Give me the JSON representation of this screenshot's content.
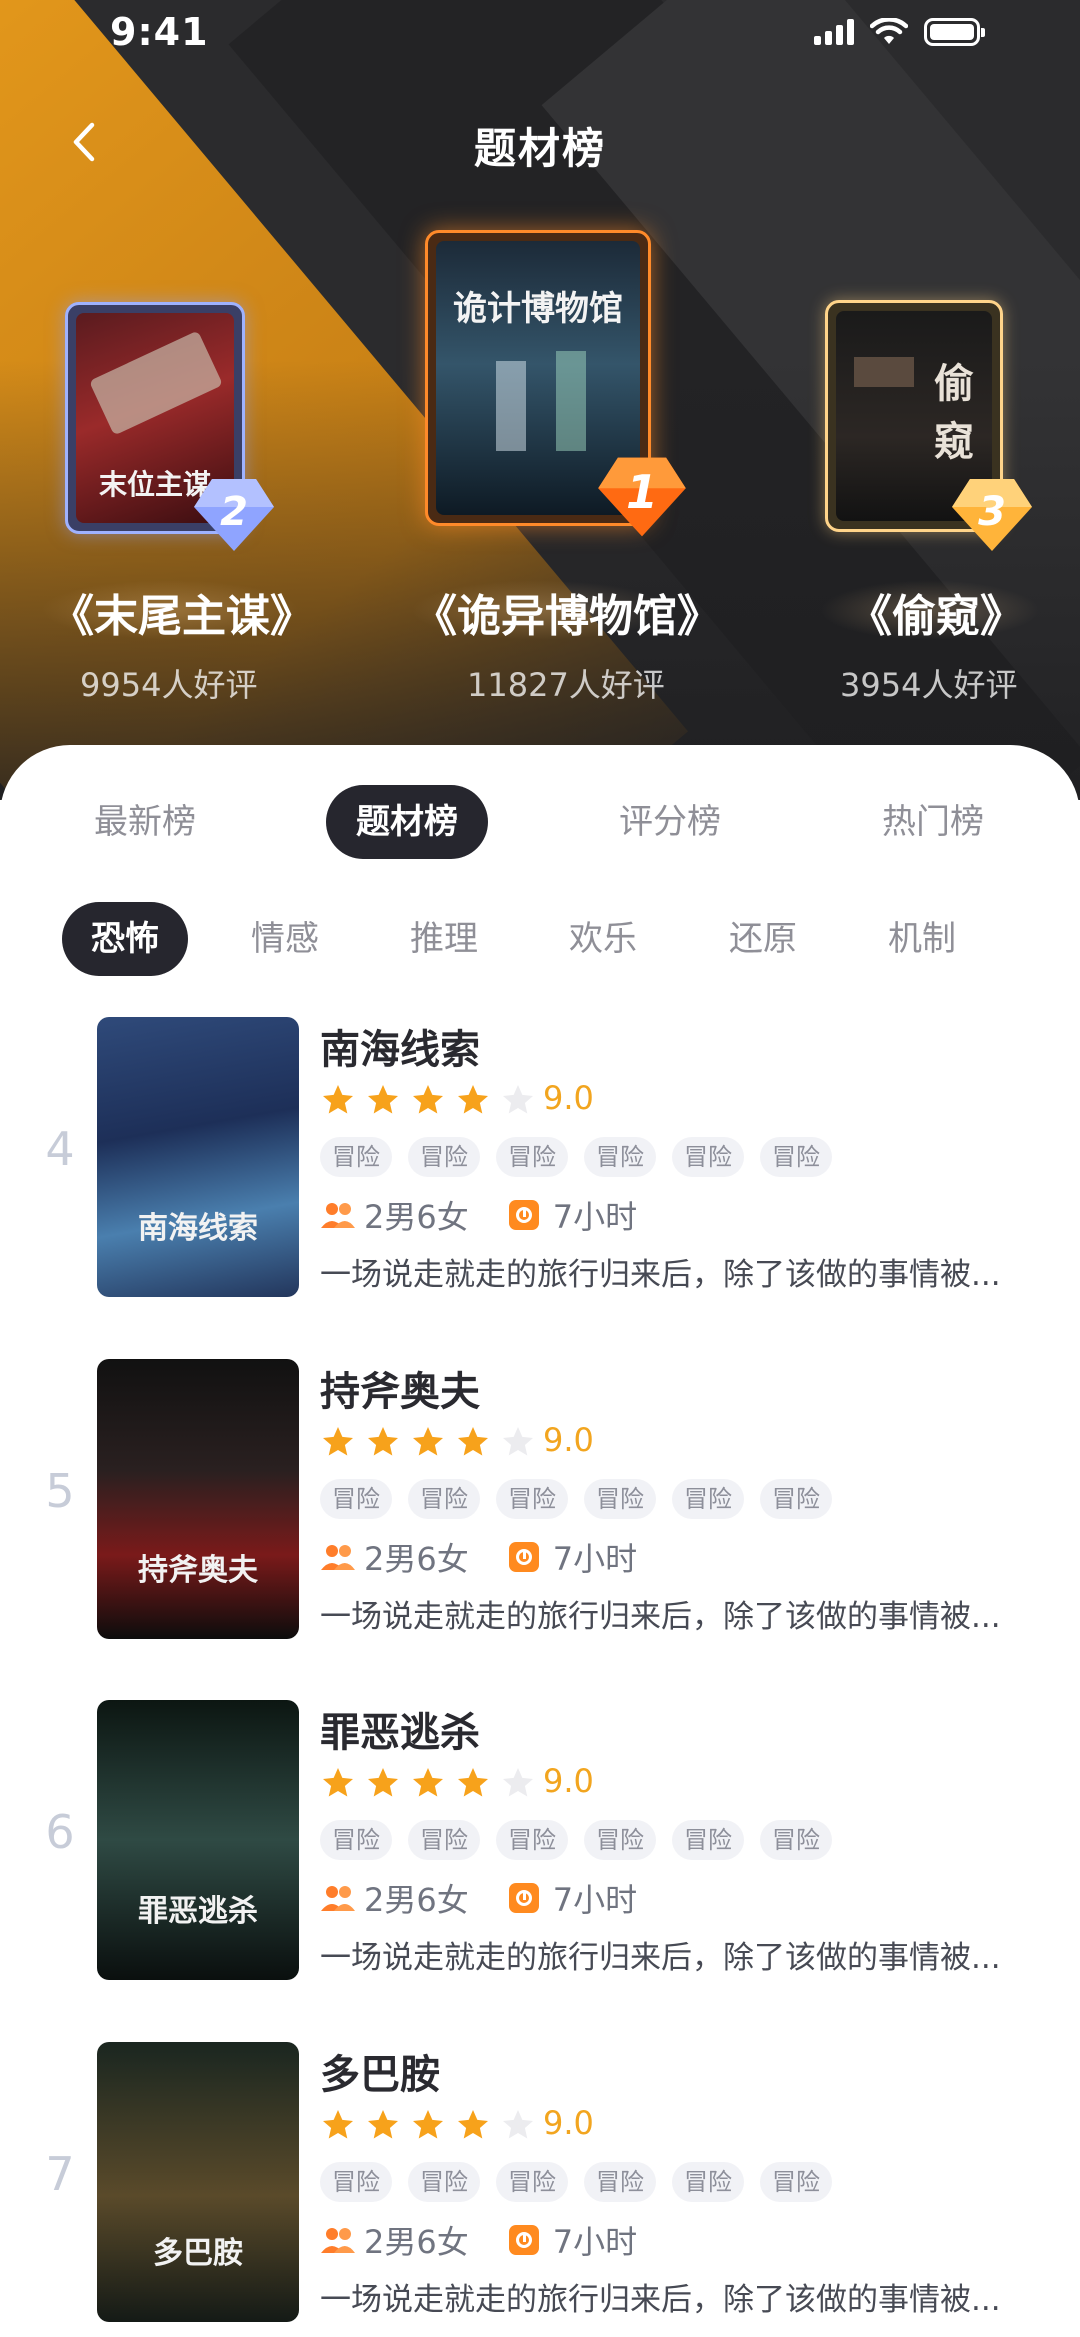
{
  "status_bar": {
    "time": "9:41"
  },
  "header": {
    "title": "题材榜",
    "back_icon": "chevron-left-icon"
  },
  "podium": [
    {
      "rank_label": "2",
      "title": "《末尾主谋》",
      "score_text": "9954人好评",
      "poster_text": "末位主谋",
      "medal_color": "#8fa4ff"
    },
    {
      "rank_label": "1",
      "title": "《诡异博物馆》",
      "score_text": "11827人好评",
      "poster_text": "诡计博物馆",
      "medal_color": "#ff7a1a"
    },
    {
      "rank_label": "3",
      "title": "《偷窥》",
      "score_text": "3954人好评",
      "poster_text": "偷窥",
      "medal_color": "#ffb43a"
    }
  ],
  "tabs": [
    {
      "label": "最新榜",
      "active": false
    },
    {
      "label": "题材榜",
      "active": true
    },
    {
      "label": "评分榜",
      "active": false
    },
    {
      "label": "热门榜",
      "active": false
    }
  ],
  "categories": [
    {
      "label": "恐怖",
      "active": true
    },
    {
      "label": "情感",
      "active": false
    },
    {
      "label": "推理",
      "active": false
    },
    {
      "label": "欢乐",
      "active": false
    },
    {
      "label": "还原",
      "active": false
    },
    {
      "label": "机制",
      "active": false
    }
  ],
  "items": [
    {
      "rank": "4",
      "title": "南海线索",
      "rating_stars": 4,
      "score": "9.0",
      "tags": [
        "冒险",
        "冒险",
        "冒险",
        "冒险",
        "冒险",
        "冒险"
      ],
      "players": "2男6女",
      "duration": "7小时",
      "desc": "一场说走就走的旅行归来后，除了该做的事情被...",
      "cover_text": "南海线索"
    },
    {
      "rank": "5",
      "title": "持斧奥夫",
      "rating_stars": 4,
      "score": "9.0",
      "tags": [
        "冒险",
        "冒险",
        "冒险",
        "冒险",
        "冒险",
        "冒险"
      ],
      "players": "2男6女",
      "duration": "7小时",
      "desc": "一场说走就走的旅行归来后，除了该做的事情被...",
      "cover_text": "持斧奥夫"
    },
    {
      "rank": "6",
      "title": "罪恶逃杀",
      "rating_stars": 4,
      "score": "9.0",
      "tags": [
        "冒险",
        "冒险",
        "冒险",
        "冒险",
        "冒险",
        "冒险"
      ],
      "players": "2男6女",
      "duration": "7小时",
      "desc": "一场说走就走的旅行归来后，除了该做的事情被...",
      "cover_text": "罪恶逃杀"
    },
    {
      "rank": "7",
      "title": "多巴胺",
      "rating_stars": 4,
      "score": "9.0",
      "tags": [
        "冒险",
        "冒险",
        "冒险",
        "冒险",
        "冒险",
        "冒险"
      ],
      "players": "2男6女",
      "duration": "7小时",
      "desc": "一场说走就走的旅行归来后，除了该做的事情被...",
      "cover_text": "多巴胺"
    }
  ],
  "colors": {
    "accent_orange": "#f2a51f",
    "dark_pill": "#26262e",
    "muted_text": "#8f8f97"
  }
}
